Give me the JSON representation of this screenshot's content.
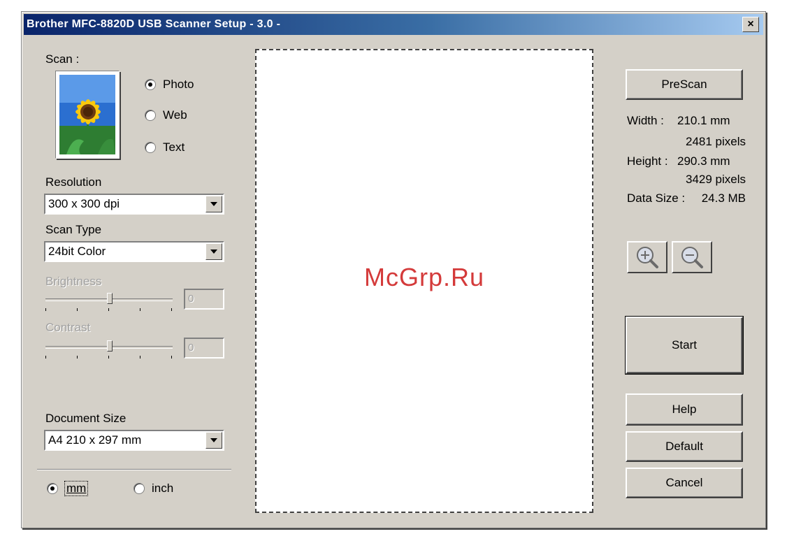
{
  "window": {
    "title": "Brother MFC-8820D USB Scanner Setup - 3.0 -",
    "close_label": "×"
  },
  "scan": {
    "label": "Scan :",
    "options": [
      {
        "label": "Photo",
        "selected": true
      },
      {
        "label": "Web",
        "selected": false
      },
      {
        "label": "Text",
        "selected": false
      }
    ]
  },
  "resolution": {
    "label": "Resolution",
    "value": "300 x 300 dpi"
  },
  "scan_type": {
    "label": "Scan Type",
    "value": "24bit Color"
  },
  "brightness": {
    "label": "Brightness",
    "value": "0",
    "level": 0.5
  },
  "contrast": {
    "label": "Contrast",
    "value": "0",
    "level": 0.5
  },
  "document_size": {
    "label": "Document Size",
    "value": "A4 210 x 297 mm"
  },
  "units": {
    "mm_label": "mm",
    "inch_label": "inch",
    "selected": "mm"
  },
  "watermark": "McGrp.Ru",
  "prescan_label": "PreScan",
  "info": {
    "width_label": "Width :",
    "width_mm": "210.1 mm",
    "width_px": "2481 pixels",
    "height_label": "Height :",
    "height_mm": "290.3 mm",
    "height_px": "3429 pixels",
    "datasize_label": "Data Size :",
    "datasize_value": "24.3 MB"
  },
  "buttons": {
    "start": "Start",
    "help": "Help",
    "default": "Default",
    "cancel": "Cancel"
  },
  "icons": {
    "zoom_in": "zoom-in-icon",
    "zoom_out": "zoom-out-icon",
    "photo": "sunflower-photo-icon"
  }
}
